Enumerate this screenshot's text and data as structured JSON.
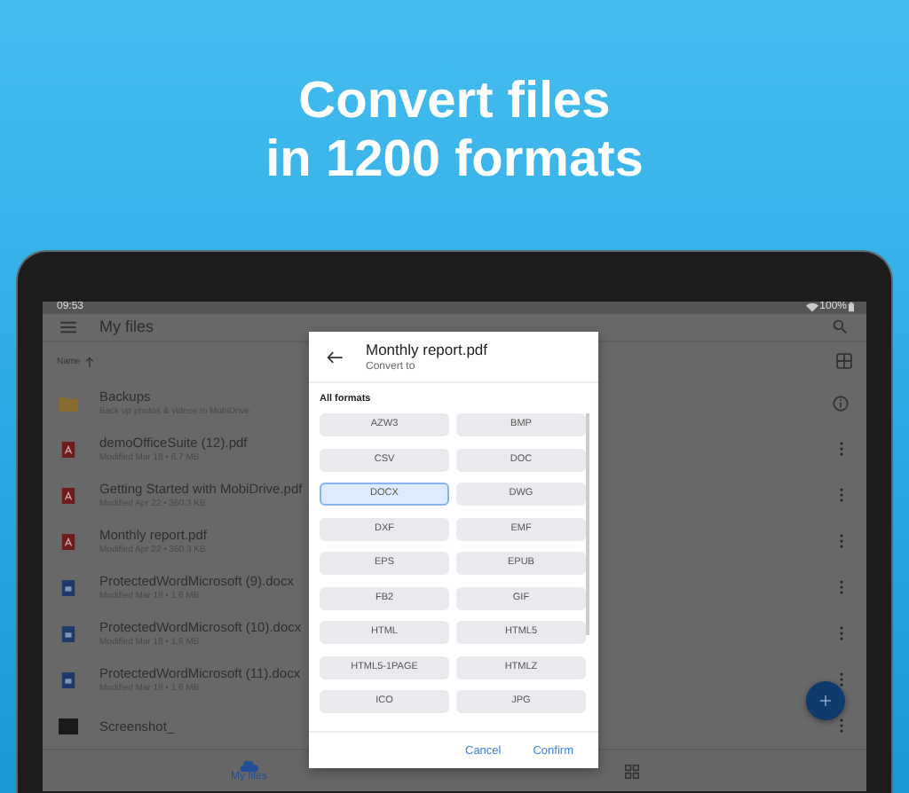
{
  "headline": [
    "Convert files",
    "in 1200 formats"
  ],
  "status_bar": {
    "time": "09:53",
    "battery": "100%"
  },
  "app_bar": {
    "title": "My files"
  },
  "sort_header": {
    "label": "Name"
  },
  "files": [
    {
      "kind": "folder",
      "name": "Backups",
      "details": "Back up photos & videos to MobiDrive"
    },
    {
      "kind": "pdf",
      "name": "demoOfficeSuite (12).pdf",
      "details": "Modified Mar 18 • 6.7 MB"
    },
    {
      "kind": "pdf",
      "name": "Getting Started with MobiDrive.pdf",
      "details": "Modified Apr 22 • 360.3 KB"
    },
    {
      "kind": "pdf",
      "name": "Monthly report.pdf",
      "details": "Modified Apr 22 • 360.3 KB"
    },
    {
      "kind": "doc",
      "name": "ProtectedWordMicrosoft (9).docx",
      "details": "Modified Mar 18 • 1.6 MB"
    },
    {
      "kind": "doc",
      "name": "ProtectedWordMicrosoft (10).docx",
      "details": "Modified Mar 18 • 1.6 MB"
    },
    {
      "kind": "doc",
      "name": "ProtectedWordMicrosoft (11).docx",
      "details": "Modified Mar 18 • 1.6 MB"
    },
    {
      "kind": "image",
      "name": "Screenshot_"
    }
  ],
  "bottom_nav": [
    {
      "label": "My files",
      "selected": true
    }
  ],
  "dialog": {
    "title": "Monthly report.pdf",
    "subtitle": "Convert to",
    "section": "All formats",
    "formats": [
      {
        "label": "AZW3",
        "selected": false
      },
      {
        "label": "BMP",
        "selected": false
      },
      {
        "label": "CSV",
        "selected": false
      },
      {
        "label": "DOC",
        "selected": false
      },
      {
        "label": "DOCX",
        "selected": true
      },
      {
        "label": "DWG",
        "selected": false
      },
      {
        "label": "DXF",
        "selected": false
      },
      {
        "label": "EMF",
        "selected": false
      },
      {
        "label": "EPS",
        "selected": false
      },
      {
        "label": "EPUB",
        "selected": false
      },
      {
        "label": "FB2",
        "selected": false
      },
      {
        "label": "GIF",
        "selected": false
      },
      {
        "label": "HTML",
        "selected": false
      },
      {
        "label": "HTML5",
        "selected": false
      },
      {
        "label": "HTML5-1PAGE",
        "selected": false
      },
      {
        "label": "HTMLZ",
        "selected": false
      },
      {
        "label": "ICO",
        "selected": false
      },
      {
        "label": "JPG",
        "selected": false
      }
    ],
    "buttons": [
      "Cancel",
      "Confirm"
    ]
  }
}
